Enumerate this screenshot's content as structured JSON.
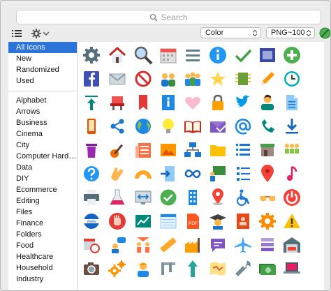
{
  "search": {
    "placeholder": "Search"
  },
  "toolbar": {
    "style_select": "Color",
    "format_select": "PNG~100",
    "list_view": "list-view-icon",
    "settings": "gear-icon"
  },
  "sidebar": {
    "top_items": [
      "All Icons",
      "New",
      "Randomized",
      "Used"
    ],
    "selected": "All Icons",
    "categories": [
      "Alphabet",
      "Arrows",
      "Business",
      "Cinema",
      "City",
      "Computer Hard…",
      "Data",
      "DIY",
      "Ecommerce",
      "Editing",
      "Files",
      "Finance",
      "Folders",
      "Food",
      "Healthcare",
      "Household",
      "Industry"
    ]
  },
  "colors": {
    "accent": "#2d74da",
    "grid_bg": "#ffffff",
    "window_bg": "#ececec"
  },
  "icons": [
    [
      "settings-icon",
      "home-icon",
      "search-icon",
      "calendar-icon",
      "menu-icon",
      "info-icon",
      "checkmark-icon",
      "picture-frame-icon",
      "plus-icon"
    ],
    [
      "facebook-icon",
      "envelope-icon",
      "no-entry-icon",
      "group-icon",
      "conference-icon",
      "star-icon",
      "chip-icon",
      "pencil-icon",
      "clock-icon"
    ],
    [
      "upload-icon",
      "tools-icon",
      "bookmark-icon",
      "info-card-icon",
      "heart-icon",
      "lock-icon",
      "twitter-icon",
      "user-icon",
      "document-icon"
    ],
    [
      "smartphone-icon",
      "share-icon",
      "globe-icon",
      "idea-icon",
      "open-book-icon",
      "money-envelope-icon",
      "at-sign-icon",
      "phone-icon",
      "download-icon"
    ],
    [
      "trash-icon",
      "guitar-icon",
      "newspaper-icon",
      "image-icon",
      "org-chart-icon",
      "folder-icon",
      "list-icon",
      "shop-icon",
      "team-icon"
    ],
    [
      "help-icon",
      "clapping-icon",
      "protractor-icon",
      "import-icon",
      "infinity-icon",
      "classroom-icon",
      "checklist-icon",
      "marker-icon",
      "music-icon"
    ],
    [
      "printer-icon",
      "chemistry-icon",
      "sorting-icon",
      "approval-icon",
      "city-building-icon",
      "location-icon",
      "wheelchair-icon",
      "glasses-icon",
      "power-icon"
    ],
    [
      "www-icon",
      "stop-hand-icon",
      "line-chart-icon",
      "data-sheet-icon",
      "pdf-icon",
      "graduation-icon",
      "address-book-icon",
      "gear-orange-icon",
      "warning-icon"
    ],
    [
      "event-icon",
      "support-icon",
      "teamwork-icon",
      "ruler-icon",
      "factory-icon",
      "speech-bubble-icon",
      "airplane-icon",
      "database-icon",
      "garage-icon"
    ],
    [
      "camera-icon",
      "gears-icon",
      "engineer-icon",
      "caliper-icon",
      "arrow-up-icon",
      "map-icon",
      "wrench-icon",
      "money-icon",
      "laptop-icon"
    ]
  ]
}
